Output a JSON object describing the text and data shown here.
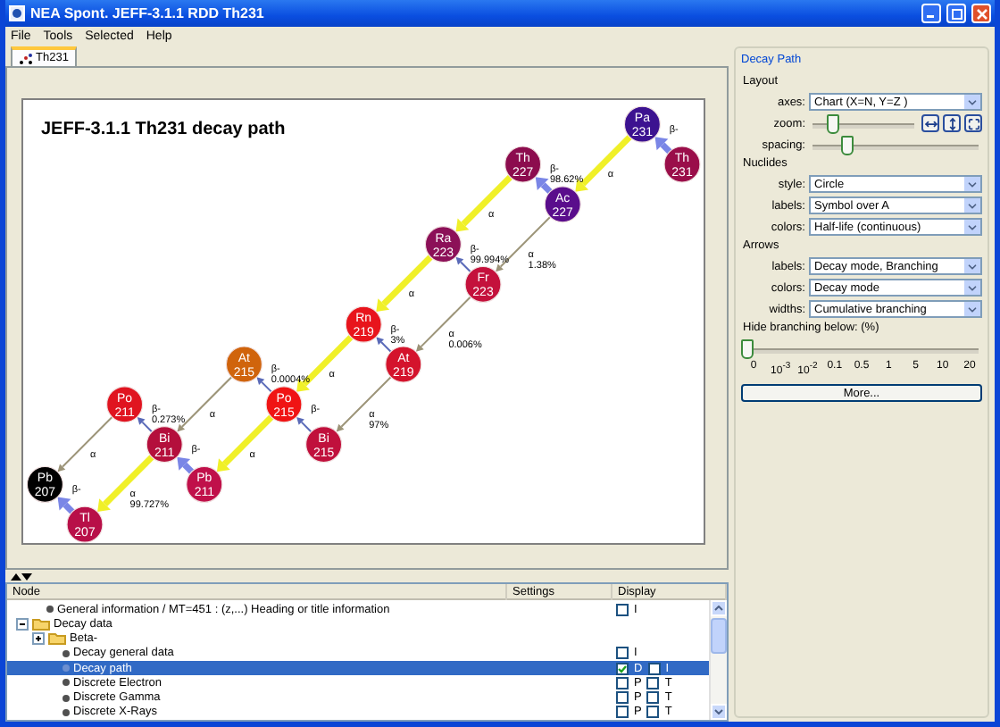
{
  "window": {
    "title": "NEA Spont. JEFF-3.1.1 RDD Th231"
  },
  "menu": [
    "File",
    "Tools",
    "Selected",
    "Help"
  ],
  "tabs": [
    {
      "label": "Th231",
      "selected": true
    }
  ],
  "chart": {
    "title": "JEFF-3.1.1 Th231 decay path",
    "nuclide": {
      "symbol": "Th",
      "mass": "231",
      "color": "#9a0e4a",
      "decays": [
        {
          "kind": "beta",
          "main": true,
          "mode": "β-",
          "product": {
            "symbol": "Pa",
            "mass": "231",
            "color": "#3c1290",
            "decays": [
              {
                "kind": "alpha",
                "main": true,
                "mode": "α",
                "product": {
                  "symbol": "Ac",
                  "mass": "227",
                  "color": "#5a0d8c",
                  "decays": [
                    {
                      "kind": "beta",
                      "main": true,
                      "mode": "β-",
                      "branching": "98.62%",
                      "product": {
                        "symbol": "Th",
                        "mass": "227",
                        "color": "#8c0c4e",
                        "decays": [
                          {
                            "kind": "alpha",
                            "main": true,
                            "mode": "α",
                            "product": {
                              "symbol": "Ra",
                              "mass": "223",
                              "color": "#8c1058",
                              "decays": [
                                {
                                  "kind": "alpha",
                                  "main": true,
                                  "mode": "α",
                                  "product": {
                                    "symbol": "Rn",
                                    "mass": "219",
                                    "color": "#e8141c",
                                    "decays": [
                                      {
                                        "kind": "alpha",
                                        "main": true,
                                        "mode": "α",
                                        "product": {
                                          "symbol": "Po",
                                          "mass": "215",
                                          "color": "#f01414",
                                          "decays": [
                                            {
                                              "kind": "beta",
                                              "main": false,
                                              "mode": "β-",
                                              "branching": "0.0004%",
                                              "product": {
                                                "symbol": "At",
                                                "mass": "215",
                                                "color": "#d0640c",
                                                "decays": [
                                                  {
                                                    "kind": "alpha",
                                                    "main": false,
                                                    "mode": "α"
                                                  }
                                                ]
                                              }
                                            },
                                            {
                                              "kind": "alpha",
                                              "main": true,
                                              "mode": "α",
                                              "product": {
                                                "symbol": "Pb",
                                                "mass": "211",
                                                "color": "#c0104a",
                                                "decays": [
                                                  {
                                                    "kind": "beta",
                                                    "main": true,
                                                    "mode": "β-",
                                                    "product": {
                                                      "symbol": "Bi",
                                                      "mass": "211",
                                                      "color": "#b40f3c",
                                                      "decays": [
                                                        {
                                                          "kind": "beta",
                                                          "main": false,
                                                          "mode": "β-",
                                                          "branching": "0.273%",
                                                          "product": {
                                                            "symbol": "Po",
                                                            "mass": "211",
                                                            "color": "#e01420",
                                                            "decays": [
                                                              {
                                                                "kind": "alpha",
                                                                "main": false,
                                                                "mode": "α"
                                                              }
                                                            ]
                                                          }
                                                        },
                                                        {
                                                          "kind": "alpha",
                                                          "main": true,
                                                          "mode": "α",
                                                          "branching": "99.727%",
                                                          "product": {
                                                            "symbol": "Tl",
                                                            "mass": "207",
                                                            "color": "#b80f48",
                                                            "decays": [
                                                              {
                                                                "kind": "beta",
                                                                "main": true,
                                                                "mode": "β-",
                                                                "product": {
                                                                  "symbol": "Pb",
                                                                  "mass": "207",
                                                                  "color": "#000000"
                                                                }
                                                              }
                                                            ]
                                                          }
                                                        }
                                                      ]
                                                    }
                                                  }
                                                ]
                                              }
                                            }
                                          ]
                                        }
                                      }
                                    ]
                                  }
                                }
                              ]
                            }
                          }
                        ]
                      }
                    },
                    {
                      "kind": "alpha",
                      "main": false,
                      "mode": "α",
                      "branching": "1.38%",
                      "product": {
                        "symbol": "Fr",
                        "mass": "223",
                        "color": "#c4113c",
                        "decays": [
                          {
                            "kind": "beta",
                            "main": false,
                            "mode": "β-",
                            "branching": "99.994%"
                          },
                          {
                            "kind": "alpha",
                            "main": false,
                            "mode": "α",
                            "branching": "0.006%",
                            "product": {
                              "symbol": "At",
                              "mass": "219",
                              "color": "#d4132c",
                              "decays": [
                                {
                                  "kind": "beta",
                                  "main": false,
                                  "mode": "β-",
                                  "branching": "3%"
                                },
                                {
                                  "kind": "alpha",
                                  "main": false,
                                  "mode": "α",
                                  "branching": "97%",
                                  "product": {
                                    "symbol": "Bi",
                                    "mass": "215",
                                    "color": "#c0103c",
                                    "decays": [
                                      {
                                        "kind": "beta",
                                        "main": false,
                                        "mode": "β-"
                                      }
                                    ]
                                  }
                                }
                              ]
                            }
                          }
                        ]
                      }
                    }
                  ]
                }
              }
            ]
          }
        }
      ]
    }
  },
  "tree": {
    "columns": [
      "Node",
      "Settings",
      "Display"
    ],
    "rows": [
      {
        "kind": "leaf",
        "label": "General information / MT=451 : (z,...) Heading or title information",
        "selected": false,
        "display": [
          {
            "label": "I",
            "checked": false
          }
        ]
      },
      {
        "kind": "folder",
        "label": "Decay data",
        "expanded": true,
        "selected": false,
        "children": [
          {
            "kind": "folder",
            "label": "Beta-",
            "expanded": false,
            "selected": false
          },
          {
            "kind": "leaf",
            "label": "Decay general data",
            "selected": false,
            "display": [
              {
                "label": "I",
                "checked": false
              }
            ]
          },
          {
            "kind": "leaf",
            "label": "Decay path",
            "selected": true,
            "display": [
              {
                "label": "D",
                "checked": true
              },
              {
                "label": "I",
                "checked": false
              }
            ]
          },
          {
            "kind": "leaf",
            "label": "Discrete Electron",
            "selected": false,
            "display": [
              {
                "label": "P",
                "checked": false
              },
              {
                "label": "T",
                "checked": false
              }
            ]
          },
          {
            "kind": "leaf",
            "label": "Discrete Gamma",
            "selected": false,
            "display": [
              {
                "label": "P",
                "checked": false
              },
              {
                "label": "T",
                "checked": false
              }
            ]
          },
          {
            "kind": "leaf",
            "label": "Discrete X-Rays",
            "selected": false,
            "display": [
              {
                "label": "P",
                "checked": false
              },
              {
                "label": "T",
                "checked": false
              }
            ]
          }
        ]
      }
    ]
  },
  "panel": {
    "title": "Decay Path",
    "sections": [
      {
        "heading": "Layout",
        "rows": [
          {
            "kind": "select",
            "label": "axes:",
            "value": "Chart (X=N, Y=Z )"
          },
          {
            "kind": "zoom_slider",
            "label": "zoom:",
            "level": 0.18
          },
          {
            "kind": "slider",
            "label": "spacing:",
            "level": 0.2
          }
        ]
      },
      {
        "heading": "Nuclides",
        "rows": [
          {
            "kind": "select",
            "label": "style:",
            "value": "Circle"
          },
          {
            "kind": "select",
            "label": "labels:",
            "value": "Symbol over A"
          },
          {
            "kind": "select",
            "label": "colors:",
            "value": "Half-life (continuous)"
          }
        ]
      },
      {
        "heading": "Arrows",
        "rows": [
          {
            "kind": "select",
            "label": "labels:",
            "value": "Decay mode, Branching"
          },
          {
            "kind": "select",
            "label": "colors:",
            "value": "Decay mode"
          },
          {
            "kind": "select",
            "label": "widths:",
            "value": "Cumulative branching"
          }
        ]
      }
    ],
    "threshold": {
      "label": "Hide branching below: (%)",
      "level": 0,
      "ticks": [
        "0",
        "10$^{-3}$",
        "10$^{-2}$",
        "0.1",
        "0.5",
        "1",
        "5",
        "10",
        "20"
      ]
    },
    "more_button": "More..."
  }
}
